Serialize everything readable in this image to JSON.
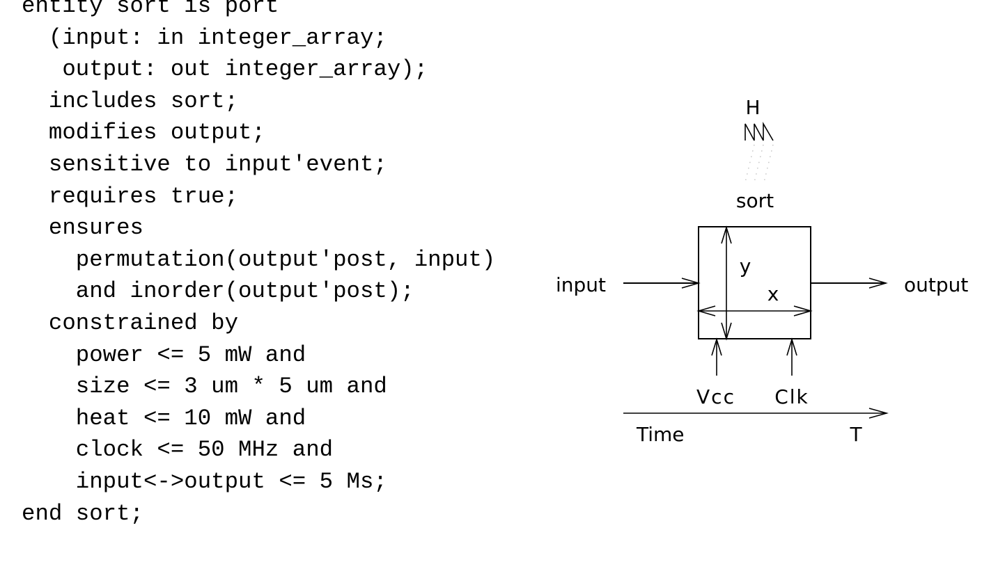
{
  "code": {
    "language": "VHDL-like entity specification",
    "lines": [
      "entity sort is port",
      "  (input: in integer_array;",
      "   output: out integer_array);",
      "  includes sort;",
      "  modifies output;",
      "  sensitive to input'event;",
      "  requires true;",
      "  ensures",
      "    permutation(output'post, input)",
      "    and inorder(output'post);",
      "  constrained by",
      "    power <= 5 mW and",
      "    size <= 3 um * 5 um and",
      "    heat <= 10 mW and",
      "    clock <= 50 MHz and",
      "    input<->output <= 5 Ms;",
      "end sort;"
    ]
  },
  "diagram": {
    "heat_label": "H",
    "heat_icon": "sawtooth-heat-icon",
    "block_label": "sort",
    "input_label": "input",
    "output_label": "output",
    "dimension_y_label": "y",
    "dimension_x_label": "x",
    "power_label": "Vcc",
    "clock_label": "Clk",
    "time_axis_label": "Time",
    "time_axis_end_label": "T"
  }
}
